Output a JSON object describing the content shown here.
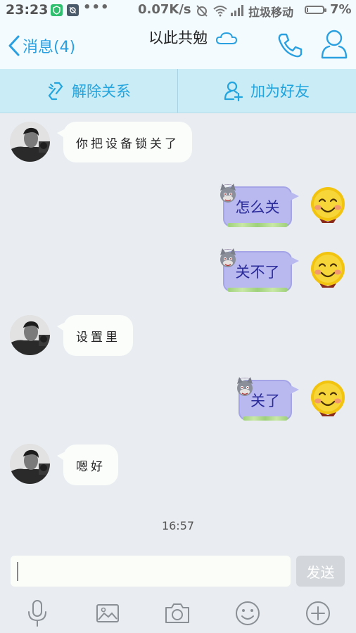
{
  "status_bar": {
    "time": "23:23",
    "dots": "•••",
    "speed": "0.07K/s",
    "carrier": "拉圾移动",
    "battery_percent": "7%",
    "battery_level": 0.07
  },
  "header": {
    "back_label": "消息(4)",
    "title": "以此共勉"
  },
  "actions": {
    "unlink_label": "解除关系",
    "add_friend_label": "加为好友"
  },
  "messages": [
    {
      "side": "left",
      "text": "你把设备锁关了"
    },
    {
      "side": "right",
      "text": "怎么关"
    },
    {
      "side": "right",
      "text": "关不了"
    },
    {
      "side": "left",
      "text": "设置里"
    },
    {
      "side": "right",
      "text": "关了"
    },
    {
      "side": "left",
      "text": "嗯好"
    }
  ],
  "timestamp": "16:57",
  "input": {
    "value": "",
    "send_label": "发送"
  },
  "toolbar": {
    "icons": [
      "microphone-icon",
      "image-icon",
      "camera-icon",
      "emoji-icon",
      "plus-icon"
    ]
  },
  "colors": {
    "accent": "#2aa0e0",
    "header_bg": "#f3fbff",
    "action_bar_bg": "#c9ecf6",
    "chat_bg": "#e9edf1",
    "bubble_left": "#fbfdfb",
    "bubble_right": "#b9b9f0"
  }
}
